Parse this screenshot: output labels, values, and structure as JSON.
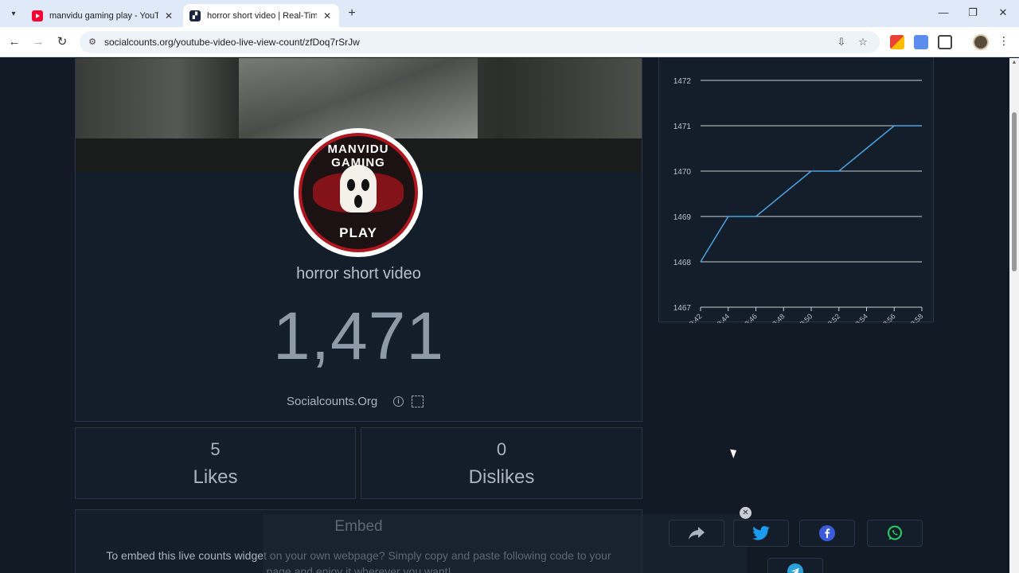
{
  "browser": {
    "tabs": [
      {
        "title": "manvidu gaming play - YouTube",
        "favicon": "youtube-icon"
      },
      {
        "title": "horror short video | Real-Time View Count",
        "favicon": "socialcounts-icon",
        "active": true
      }
    ],
    "url": "socialcounts.org/youtube-video-live-view-count/zfDoq7rSrJw"
  },
  "page": {
    "channel_logo": {
      "top_text": "MANVIDU GAMING",
      "bottom_text": "PLAY"
    },
    "video_title": "horror short video",
    "views": "1,471",
    "brand": "Socialcounts.Org",
    "likes": {
      "value": "5",
      "label": "Likes"
    },
    "dislikes": {
      "value": "0",
      "label": "Dislikes"
    },
    "embed": {
      "title": "Embed",
      "description": "To embed this live counts widget on your own webpage? Simply copy and paste following code to your page and enjoy it wherever you want!"
    },
    "share": [
      "share-icon",
      "twitter-icon",
      "facebook-icon",
      "whatsapp-icon",
      "telegram-icon"
    ]
  },
  "chart_data": {
    "type": "line",
    "x": [
      "19:43:42",
      "19:43:44",
      "19:43:46",
      "19:43:48",
      "19:43:50",
      "19:43:52",
      "19:43:54",
      "19:43:56",
      "19:43:58"
    ],
    "series": [
      {
        "name": "views",
        "values": [
          1468,
          1469,
          1469,
          1469.5,
          1470,
          1470,
          1470.5,
          1471,
          1471
        ]
      }
    ],
    "ylim": [
      1467,
      1472
    ],
    "yticks": [
      1467,
      1468,
      1469,
      1470,
      1471,
      1472
    ],
    "grid": true,
    "legend": "bottom",
    "line_color": "#4aa3df"
  }
}
